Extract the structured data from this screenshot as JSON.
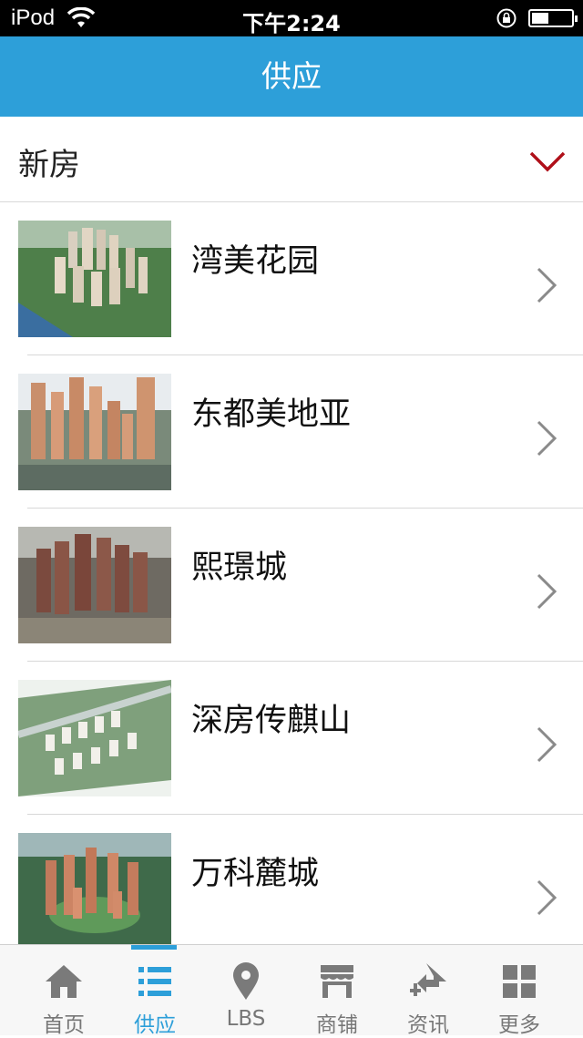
{
  "status_bar": {
    "carrier": "iPod",
    "time": "下午2:24"
  },
  "header": {
    "title": "供应"
  },
  "category": {
    "label": "新房",
    "icon": "chevron-down-icon",
    "accent_color": "#b0101a"
  },
  "list": {
    "items": [
      {
        "name": "湾美花园"
      },
      {
        "name": "东都美地亚"
      },
      {
        "name": "熙璟城"
      },
      {
        "name": "深房传麒山"
      },
      {
        "name": "万科麓城"
      }
    ]
  },
  "tabbar": {
    "active_color": "#2d9fd9",
    "tabs": [
      {
        "label": "首页",
        "icon": "home-icon"
      },
      {
        "label": "供应",
        "icon": "list-icon",
        "active": true
      },
      {
        "label": "LBS",
        "icon": "location-pin-icon"
      },
      {
        "label": "商铺",
        "icon": "shop-icon"
      },
      {
        "label": "资讯",
        "icon": "news-icon"
      },
      {
        "label": "更多",
        "icon": "grid-icon"
      }
    ]
  }
}
